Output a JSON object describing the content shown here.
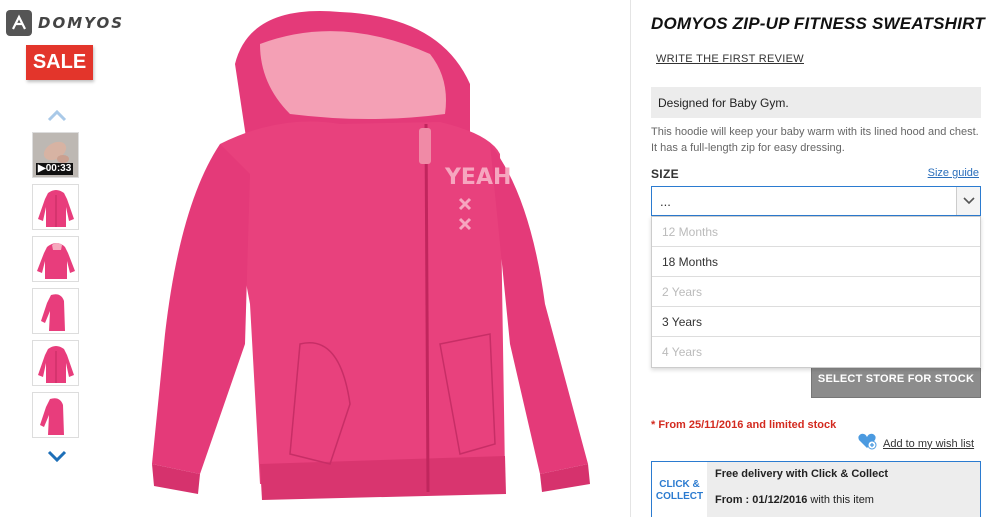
{
  "brand": {
    "logo_text": "DOMYOS",
    "sale_badge": "SALE"
  },
  "gallery": {
    "video_duration": "▶00:33",
    "thumbnails": [
      "video",
      "front",
      "side-front",
      "side",
      "front-2",
      "side-2"
    ]
  },
  "product": {
    "title": "DOMYOS ZIP-UP FITNESS SWEATSHIRT",
    "review_link": "WRITE THE FIRST REVIEW",
    "tagline": "Designed for Baby Gym.",
    "description": "This hoodie will keep your baby warm with its lined hood and chest. It has a full-length zip for easy dressing.",
    "hoodie_print": "YEAH"
  },
  "size": {
    "label": "SIZE",
    "guide_link": "Size guide",
    "selected": "...",
    "options": [
      {
        "label": "12 Months",
        "available": false
      },
      {
        "label": "18 Months",
        "available": true
      },
      {
        "label": "2 Years",
        "available": false
      },
      {
        "label": "3 Years",
        "available": true
      },
      {
        "label": "4 Years",
        "available": false
      }
    ]
  },
  "actions": {
    "store_button": "SELECT STORE FOR STOCK",
    "stock_note": "* From 25/11/2016 and limited stock",
    "wishlist": "Add to my wish list"
  },
  "click_collect": {
    "badge_line1": "CLICK &",
    "badge_line2": "COLLECT",
    "delivery": "Free delivery with Click & Collect",
    "from_label": "From : 01/12/2016",
    "from_suffix": " with this item"
  },
  "colors": {
    "accent": "#2b7bd0",
    "sale": "#e3352b",
    "product": "#e83d7c",
    "alert": "#d32a1f"
  }
}
